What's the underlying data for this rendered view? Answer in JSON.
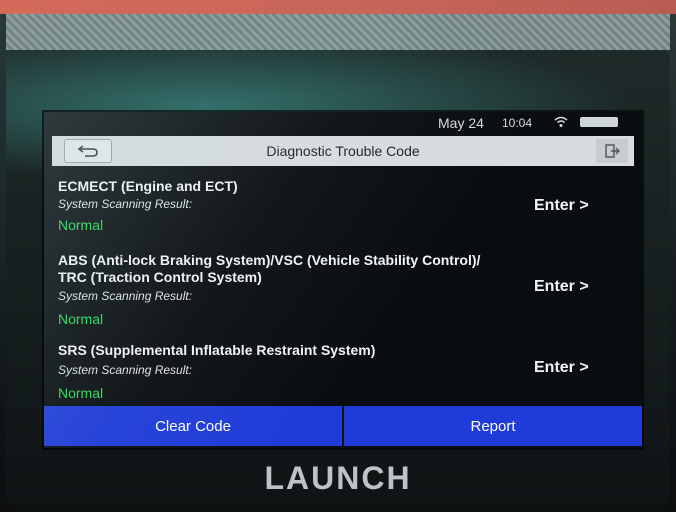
{
  "device": {
    "brand": "LAUNCH"
  },
  "status": {
    "date": "May 24",
    "time": "10:04"
  },
  "header": {
    "title": "Diagnostic Trouble Code"
  },
  "systems": [
    {
      "name_lines": [
        "ECMECT (Engine and ECT)"
      ],
      "label": "System Scanning Result:",
      "result": "Normal",
      "action": "Enter >"
    },
    {
      "name_lines": [
        "ABS (Anti-lock Braking System)/VSC (Vehicle Stability Control)/",
        "TRC (Traction Control System)"
      ],
      "label": "System Scanning Result:",
      "result": "Normal",
      "action": "Enter >"
    },
    {
      "name_lines": [
        "SRS (Supplemental Inflatable Restraint System)"
      ],
      "label": "System Scanning Result:",
      "result": "Normal",
      "action": "Enter >"
    }
  ],
  "footer": {
    "clear_label": "Clear Code",
    "report_label": "Report"
  },
  "colors": {
    "accent_blue": "#1f3bd8",
    "result_green": "#2fd65a",
    "titlebar": "#d9dcde"
  }
}
